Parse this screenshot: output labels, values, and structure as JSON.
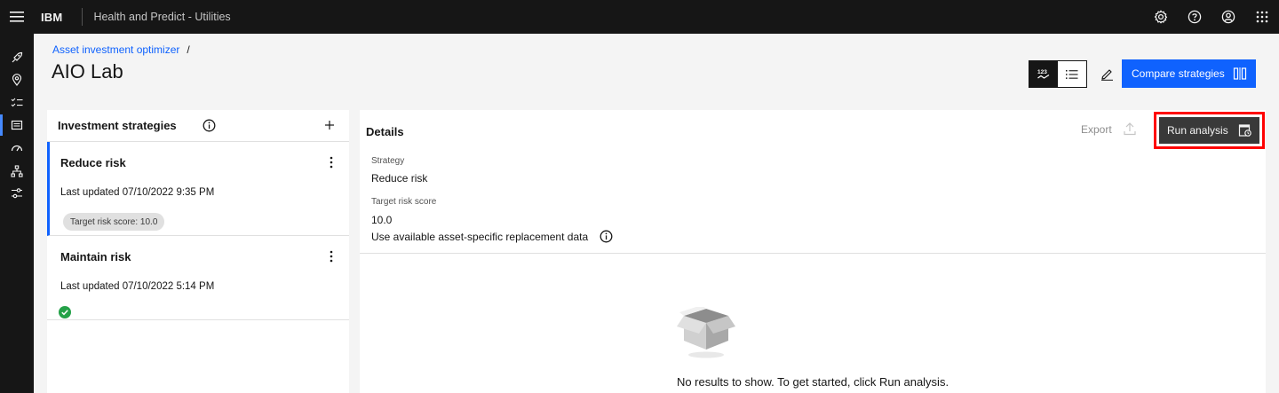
{
  "header": {
    "brand": "IBM",
    "product": "Health and Predict - Utilities",
    "icons": [
      "menu-icon",
      "settings-icon",
      "help-icon",
      "user-icon",
      "app-switcher-icon"
    ]
  },
  "rail": {
    "icons": [
      "rocket-icon",
      "location-icon",
      "checklist-icon",
      "investment-icon",
      "dashboard-gauge-icon",
      "hierarchy-icon",
      "settings-adjust-icon"
    ],
    "active_index": 3
  },
  "breadcrumb": {
    "parent": "Asset investment optimizer",
    "separator": "/"
  },
  "page": {
    "title": "AIO Lab"
  },
  "toolbar": {
    "compare_label": "Compare strategies"
  },
  "strategies_panel": {
    "title": "Investment strategies",
    "cards": [
      {
        "title": "Reduce risk",
        "updated": "Last updated 07/10/2022 9:35 PM",
        "tag": "Target risk score: 10.0"
      },
      {
        "title": "Maintain risk",
        "updated": "Last updated 07/10/2022 5:14 PM"
      }
    ]
  },
  "details": {
    "title": "Details",
    "export_label": "Export",
    "run_label": "Run analysis",
    "strategy_label": "Strategy",
    "strategy_value": "Reduce risk",
    "target_label": "Target risk score",
    "target_value": "10.0",
    "replacement_label": "Use available asset-specific replacement data",
    "empty_message": "No results to show. To get started, click Run analysis."
  },
  "colors": {
    "primary": "#0f62fe",
    "header_bg": "#161616",
    "highlight": "#ff0000",
    "success": "#24a148"
  }
}
